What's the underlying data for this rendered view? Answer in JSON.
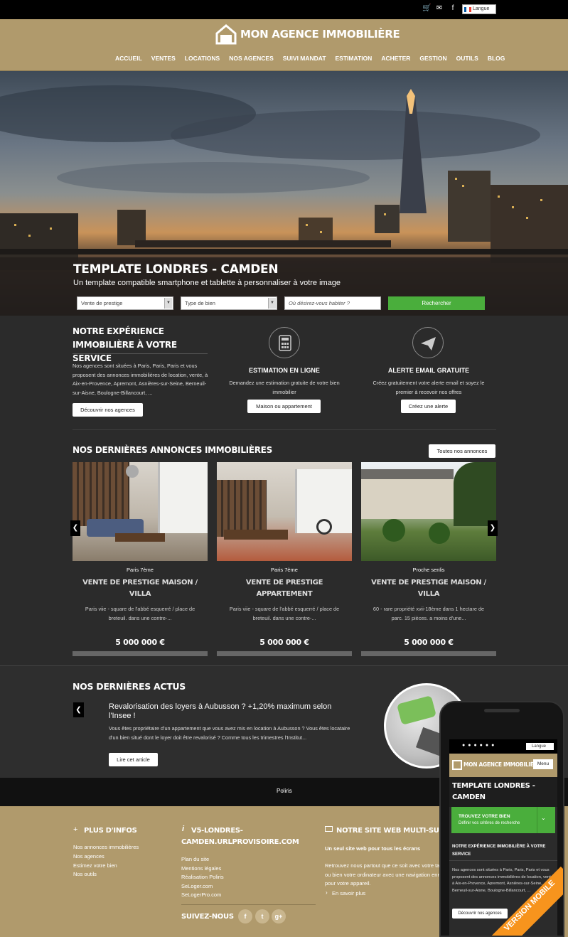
{
  "topbar": {
    "icons": [
      "cart-icon",
      "mail-icon",
      "facebook-icon",
      "twitter-icon",
      "google-plus-icon",
      "rss-icon"
    ],
    "lang_label": "Langue"
  },
  "header": {
    "logo_text": "MON AGENCE IMMOBILIÈRE",
    "nav": [
      "ACCUEIL",
      "VENTES",
      "LOCATIONS",
      "NOS AGENCES",
      "SUIVI MANDAT",
      "ESTIMATION",
      "ACHETER",
      "GESTION",
      "OUTILS",
      "BLOG"
    ]
  },
  "hero": {
    "title": "TEMPLATE LONDRES - CAMDEN",
    "subtitle": "Un template compatible smartphone et tablette à personnaliser à votre image",
    "select1": "Vente de prestige",
    "select2": "Type de bien",
    "location_placeholder": "Où désirez-vous habiter ?",
    "search_button": "Rechercher"
  },
  "services": {
    "experience_title": "NOTRE EXPÉRIENCE IMMOBILIÈRE À VOTRE SERVICE",
    "experience_text": "Nos agences sont situées à Paris, Paris, Paris et vous proposent des annonces immobilières de location, vente, à Aix-en-Provence, Apremont, Asnières-sur-Seine, Berneuil-sur-Aisne, Boulogne-Billancourt, ...",
    "experience_button": "Découvrir nos agences",
    "estimation_title": "ESTIMATION EN LIGNE",
    "estimation_text": "Demandez une estimation gratuite de votre bien immobilier",
    "estimation_button": "Maison ou appartement",
    "alert_title": "ALERTE EMAIL GRATUITE",
    "alert_text": "Créez gratuitement votre alerte email et soyez le premier à recevoir nos offres",
    "alert_button": "Créez une alerte"
  },
  "listings": {
    "title": "NOS DERNIÈRES ANNONCES IMMOBILIÈRES",
    "all_button": "Toutes nos annonces",
    "items": [
      {
        "location": "Paris 7ème",
        "title": "VENTE DE PRESTIGE MAISON / VILLA",
        "desc": "Paris viie - square de l'abbé esquerré / place de breteuil. dans une contre-...",
        "price": "5 000 000 €"
      },
      {
        "location": "Paris 7ème",
        "title": "VENTE DE PRESTIGE APPARTEMENT",
        "desc": "Paris viie - square de l'abbé esquerré / place de breteuil. dans une contre-...",
        "price": "5 000 000 €"
      },
      {
        "location": "Proche senlis",
        "title": "VENTE DE PRESTIGE MAISON / VILLA",
        "desc": "60 - rare propriété xvii-18ème dans 1 hectare de parc. 15 pièces. a moins d'une...",
        "price": "5 000 000 €"
      }
    ]
  },
  "news": {
    "title": "NOS DERNIÈRES ACTUS",
    "headline": "Revalorisation des loyers à Aubusson ? +1,20% maximum selon l'Insee !",
    "text": "Vous êtes propriétaire d'un appartement que vous avez mis en location à Aubusson ? Vous êtes locataire d'un bien situé dont le loyer doit être revalorisé ? Comme tous les trimestres l'Institut...",
    "button": "Lire cet article"
  },
  "strip": {
    "label": "Poliris"
  },
  "footer": {
    "col1_title": "PLUS D'INFOS",
    "col1_links": [
      "Nos annonces immobilières",
      "Nos agences",
      "Estimez votre bien",
      "Nos outils"
    ],
    "col2_title": "V5-LONDRES-CAMDEN.URLPROVISOIRE.COM",
    "col2_links": [
      "Plan du site",
      "Mentions légales",
      "Réalisation Poliris",
      "SeLoger.com",
      "SeLogerPro.com"
    ],
    "follow_label": "SUIVEZ-NOUS",
    "col3_title": "NOTRE SITE WEB MULTI-SUPPORTS",
    "col3_subtitle": "Un seul site web pour tous les écrans",
    "col3_text": "Retrouvez nous partout que ce soit avec votre tablette ou bien votre ordinateur avec une navigation enrichie pour votre appareil.",
    "col3_more": "En savoir plus"
  },
  "phone": {
    "lang_label": "Langue",
    "logo_text": "MON AGENCE IMMOBILIÈRE",
    "menu_button": "Menu",
    "title": "TEMPLATE LONDRES - CAMDEN",
    "find_title": "TROUVEZ VOTRE BIEN",
    "find_sub": "Définir vos critères de recherche",
    "exp_title": "NOTRE EXPÉRIENCE IMMOBILIÈRE À VOTRE SERVICE",
    "exp_text": "Nos agences sont situées à Paris, Paris, Paris et vous proposent des annonces immobilières de location, vente, à Aix-en-Provence, Apremont, Asnières-sur-Seine, Berneuil-sur-Aisne, Boulogne-Billancourt, ...",
    "exp_button": "Découvrir nos agences",
    "ribbon": "VERSION MOBILE"
  },
  "colors": {
    "gold": "#b09a6c",
    "green": "#4aae3c",
    "dark": "#2b2b2b",
    "ribbon": "#f7941d"
  }
}
